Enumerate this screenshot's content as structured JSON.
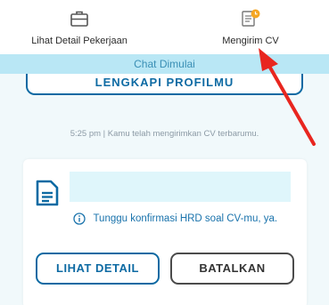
{
  "header": {
    "detail_label": "Lihat Detail Pekerjaan",
    "detail_icon": "briefcase-icon",
    "cv_label": "Mengirim CV",
    "cv_icon": "document-clock-icon"
  },
  "chat_banner": "Chat Dimulai",
  "profile_button": "LENGKAPI PROFILMU",
  "timestamp": "5:25 pm | Kamu telah mengirimkan CV terbarumu.",
  "cv_card": {
    "doc_icon": "document-icon",
    "info_icon": "info-icon",
    "info_text": "Tunggu konfirmasi HRD soal CV-mu, ya.",
    "detail_button": "LIHAT DETAIL",
    "cancel_button": "BATALKAN"
  },
  "colors": {
    "primary": "#0d6aa3",
    "banner": "#b9e7f5",
    "annotation_arrow": "#e8261f",
    "clock_badge": "#f5a623"
  }
}
